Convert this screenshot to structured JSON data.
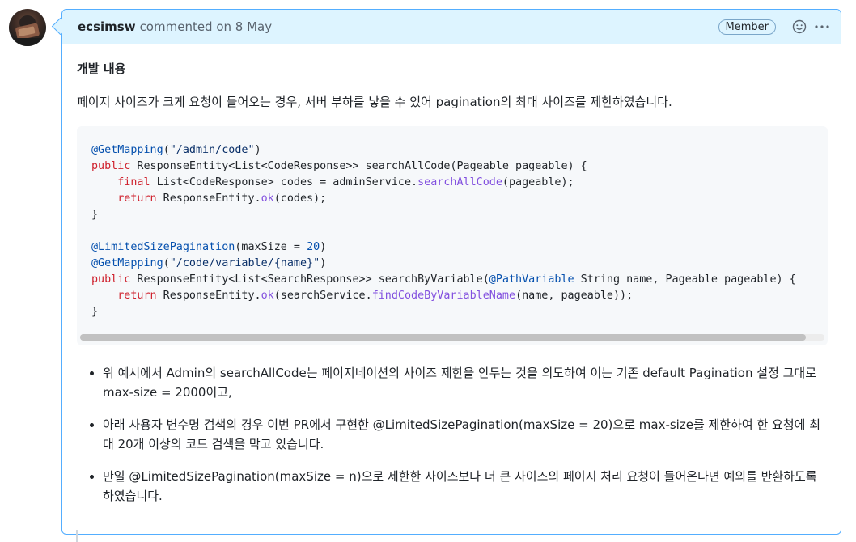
{
  "comment": {
    "author": "ecsimsw",
    "meta": "commented on 8 May",
    "badge": "Member",
    "heading": "개발 내용",
    "intro": "페이지 사이즈가 크게 요청이 들어오는 경우, 서버 부하를 낳을 수 있어 pagination의 최대 사이즈를 제한하였습니다.",
    "bullets": [
      "위 예시에서 Admin의 searchAllCode는 페이지네이션의 사이즈 제한을 안두는 것을 의도하여 이는 기존 default Pagination 설정 그대로 max-size = 2000이고,",
      "아래 사용자 변수명 검색의 경우 이번 PR에서 구현한 @LimitedSizePagination(maxSize = 20)으로 max-size를 제한하여 한 요청에 최대 20개 이상의 코드 검색을 막고 있습니다.",
      "만일 @LimitedSizePagination(maxSize = n)으로 제한한 사이즈보다 더 큰 사이즈의 페이지 처리 요청이 들어온다면 예외를 반환하도록 하였습니다."
    ]
  },
  "code": {
    "l1": [
      {
        "t": "ann",
        "v": "@GetMapping"
      },
      {
        "t": "",
        "v": "("
      },
      {
        "t": "str",
        "v": "\"/admin/code\""
      },
      {
        "t": "",
        "v": ")"
      }
    ],
    "l2": [
      {
        "t": "kw",
        "v": "public"
      },
      {
        "t": "",
        "v": " ResponseEntity<List<CodeResponse>> searchAllCode(Pageable pageable) {"
      }
    ],
    "l3": [
      {
        "t": "",
        "v": "    "
      },
      {
        "t": "kw",
        "v": "final"
      },
      {
        "t": "",
        "v": " List<CodeResponse> codes = adminService."
      },
      {
        "t": "fn",
        "v": "searchAllCode"
      },
      {
        "t": "",
        "v": "(pageable);"
      }
    ],
    "l4": [
      {
        "t": "",
        "v": "    "
      },
      {
        "t": "kw",
        "v": "return"
      },
      {
        "t": "",
        "v": " ResponseEntity."
      },
      {
        "t": "fn",
        "v": "ok"
      },
      {
        "t": "",
        "v": "(codes);"
      }
    ],
    "l5": [
      {
        "t": "",
        "v": "}"
      }
    ],
    "l6": [
      {
        "t": "",
        "v": ""
      }
    ],
    "l7": [
      {
        "t": "ann",
        "v": "@LimitedSizePagination"
      },
      {
        "t": "",
        "v": "(maxSize = "
      },
      {
        "t": "num",
        "v": "20"
      },
      {
        "t": "",
        "v": ")"
      }
    ],
    "l8": [
      {
        "t": "ann",
        "v": "@GetMapping"
      },
      {
        "t": "",
        "v": "("
      },
      {
        "t": "str",
        "v": "\"/code/variable/{name}\""
      },
      {
        "t": "",
        "v": ")"
      }
    ],
    "l9": [
      {
        "t": "kw",
        "v": "public"
      },
      {
        "t": "",
        "v": " ResponseEntity<List<SearchResponse>> searchByVariable("
      },
      {
        "t": "ann",
        "v": "@PathVariable"
      },
      {
        "t": "",
        "v": " String name, Pageable pageable) {"
      }
    ],
    "l10": [
      {
        "t": "",
        "v": "    "
      },
      {
        "t": "kw",
        "v": "return"
      },
      {
        "t": "",
        "v": " ResponseEntity."
      },
      {
        "t": "fn",
        "v": "ok"
      },
      {
        "t": "",
        "v": "(searchService."
      },
      {
        "t": "fn",
        "v": "findCodeByVariableName"
      },
      {
        "t": "",
        "v": "(name, pageable));"
      }
    ],
    "l11": [
      {
        "t": "",
        "v": "}"
      }
    ]
  },
  "icons": {
    "reaction": "smiley-icon",
    "menu": "kebab-menu-icon"
  },
  "colors": {
    "header_bg": "#ddf4ff",
    "border": "#54aeff",
    "keyword": "#cf222e",
    "annotation": "#0550ae",
    "string": "#0a3069",
    "method": "#8250df"
  }
}
